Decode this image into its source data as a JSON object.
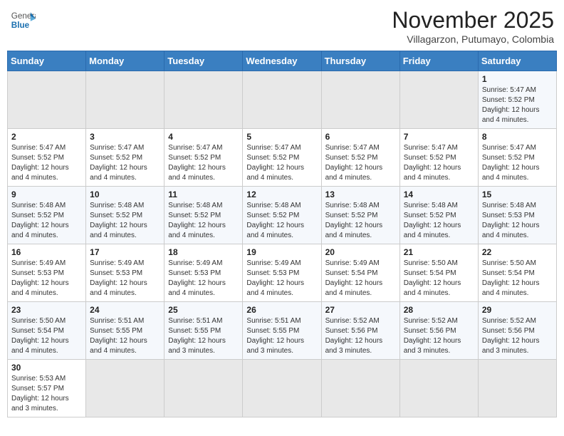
{
  "header": {
    "logo_general": "General",
    "logo_blue": "Blue",
    "month": "November 2025",
    "location": "Villagarzon, Putumayo, Colombia"
  },
  "days_of_week": [
    "Sunday",
    "Monday",
    "Tuesday",
    "Wednesday",
    "Thursday",
    "Friday",
    "Saturday"
  ],
  "weeks": [
    [
      {
        "day": "",
        "info": ""
      },
      {
        "day": "",
        "info": ""
      },
      {
        "day": "",
        "info": ""
      },
      {
        "day": "",
        "info": ""
      },
      {
        "day": "",
        "info": ""
      },
      {
        "day": "",
        "info": ""
      },
      {
        "day": "1",
        "info": "Sunrise: 5:47 AM\nSunset: 5:52 PM\nDaylight: 12 hours\nand 4 minutes."
      }
    ],
    [
      {
        "day": "2",
        "info": "Sunrise: 5:47 AM\nSunset: 5:52 PM\nDaylight: 12 hours\nand 4 minutes."
      },
      {
        "day": "3",
        "info": "Sunrise: 5:47 AM\nSunset: 5:52 PM\nDaylight: 12 hours\nand 4 minutes."
      },
      {
        "day": "4",
        "info": "Sunrise: 5:47 AM\nSunset: 5:52 PM\nDaylight: 12 hours\nand 4 minutes."
      },
      {
        "day": "5",
        "info": "Sunrise: 5:47 AM\nSunset: 5:52 PM\nDaylight: 12 hours\nand 4 minutes."
      },
      {
        "day": "6",
        "info": "Sunrise: 5:47 AM\nSunset: 5:52 PM\nDaylight: 12 hours\nand 4 minutes."
      },
      {
        "day": "7",
        "info": "Sunrise: 5:47 AM\nSunset: 5:52 PM\nDaylight: 12 hours\nand 4 minutes."
      },
      {
        "day": "8",
        "info": "Sunrise: 5:47 AM\nSunset: 5:52 PM\nDaylight: 12 hours\nand 4 minutes."
      }
    ],
    [
      {
        "day": "9",
        "info": "Sunrise: 5:48 AM\nSunset: 5:52 PM\nDaylight: 12 hours\nand 4 minutes."
      },
      {
        "day": "10",
        "info": "Sunrise: 5:48 AM\nSunset: 5:52 PM\nDaylight: 12 hours\nand 4 minutes."
      },
      {
        "day": "11",
        "info": "Sunrise: 5:48 AM\nSunset: 5:52 PM\nDaylight: 12 hours\nand 4 minutes."
      },
      {
        "day": "12",
        "info": "Sunrise: 5:48 AM\nSunset: 5:52 PM\nDaylight: 12 hours\nand 4 minutes."
      },
      {
        "day": "13",
        "info": "Sunrise: 5:48 AM\nSunset: 5:52 PM\nDaylight: 12 hours\nand 4 minutes."
      },
      {
        "day": "14",
        "info": "Sunrise: 5:48 AM\nSunset: 5:52 PM\nDaylight: 12 hours\nand 4 minutes."
      },
      {
        "day": "15",
        "info": "Sunrise: 5:48 AM\nSunset: 5:53 PM\nDaylight: 12 hours\nand 4 minutes."
      }
    ],
    [
      {
        "day": "16",
        "info": "Sunrise: 5:49 AM\nSunset: 5:53 PM\nDaylight: 12 hours\nand 4 minutes."
      },
      {
        "day": "17",
        "info": "Sunrise: 5:49 AM\nSunset: 5:53 PM\nDaylight: 12 hours\nand 4 minutes."
      },
      {
        "day": "18",
        "info": "Sunrise: 5:49 AM\nSunset: 5:53 PM\nDaylight: 12 hours\nand 4 minutes."
      },
      {
        "day": "19",
        "info": "Sunrise: 5:49 AM\nSunset: 5:53 PM\nDaylight: 12 hours\nand 4 minutes."
      },
      {
        "day": "20",
        "info": "Sunrise: 5:49 AM\nSunset: 5:54 PM\nDaylight: 12 hours\nand 4 minutes."
      },
      {
        "day": "21",
        "info": "Sunrise: 5:50 AM\nSunset: 5:54 PM\nDaylight: 12 hours\nand 4 minutes."
      },
      {
        "day": "22",
        "info": "Sunrise: 5:50 AM\nSunset: 5:54 PM\nDaylight: 12 hours\nand 4 minutes."
      }
    ],
    [
      {
        "day": "23",
        "info": "Sunrise: 5:50 AM\nSunset: 5:54 PM\nDaylight: 12 hours\nand 4 minutes."
      },
      {
        "day": "24",
        "info": "Sunrise: 5:51 AM\nSunset: 5:55 PM\nDaylight: 12 hours\nand 4 minutes."
      },
      {
        "day": "25",
        "info": "Sunrise: 5:51 AM\nSunset: 5:55 PM\nDaylight: 12 hours\nand 3 minutes."
      },
      {
        "day": "26",
        "info": "Sunrise: 5:51 AM\nSunset: 5:55 PM\nDaylight: 12 hours\nand 3 minutes."
      },
      {
        "day": "27",
        "info": "Sunrise: 5:52 AM\nSunset: 5:56 PM\nDaylight: 12 hours\nand 3 minutes."
      },
      {
        "day": "28",
        "info": "Sunrise: 5:52 AM\nSunset: 5:56 PM\nDaylight: 12 hours\nand 3 minutes."
      },
      {
        "day": "29",
        "info": "Sunrise: 5:52 AM\nSunset: 5:56 PM\nDaylight: 12 hours\nand 3 minutes."
      }
    ],
    [
      {
        "day": "30",
        "info": "Sunrise: 5:53 AM\nSunset: 5:57 PM\nDaylight: 12 hours\nand 3 minutes."
      },
      {
        "day": "",
        "info": ""
      },
      {
        "day": "",
        "info": ""
      },
      {
        "day": "",
        "info": ""
      },
      {
        "day": "",
        "info": ""
      },
      {
        "day": "",
        "info": ""
      },
      {
        "day": "",
        "info": ""
      }
    ]
  ]
}
